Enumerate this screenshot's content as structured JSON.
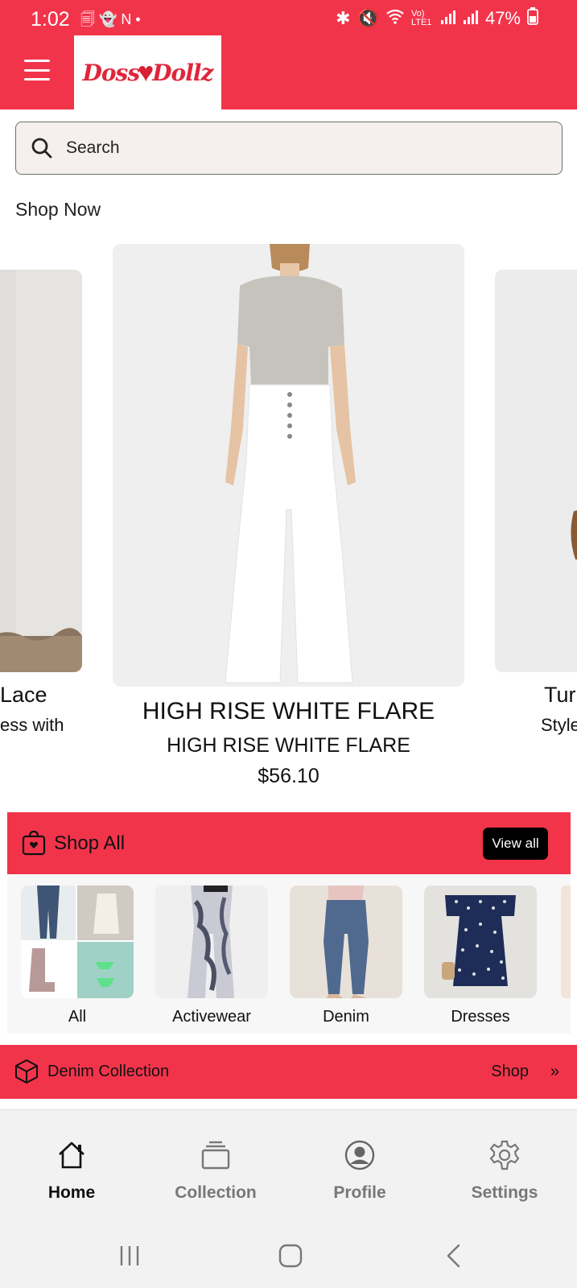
{
  "status_bar": {
    "time": "1:02",
    "notif_glyphs": "🗐 👻 N •",
    "network": "Vo) LTE1",
    "battery": "47%"
  },
  "app_bar": {
    "logo_left": "Doss",
    "logo_right": "Dollz"
  },
  "search": {
    "placeholder": "Search"
  },
  "shop_now": {
    "label": "Shop Now",
    "left_card": {
      "title": "Lace",
      "subtitle": "ess with"
    },
    "center_card": {
      "title": "HIGH RISE WHITE FLARE",
      "subtitle": "HIGH RISE WHITE FLARE",
      "price": "$56.10"
    },
    "right_card": {
      "title": "Tur",
      "subtitle": "Style"
    }
  },
  "shop_all": {
    "title": "Shop All",
    "view_all": "View all",
    "categories": [
      {
        "label": "All"
      },
      {
        "label": "Activewear"
      },
      {
        "label": "Denim"
      },
      {
        "label": "Dresses"
      }
    ]
  },
  "denim_collection": {
    "title": "Denim Collection",
    "shop": "Shop",
    "chevron": "»"
  },
  "bottom_nav": {
    "items": [
      {
        "label": "Home",
        "icon": "home-icon",
        "active": true
      },
      {
        "label": "Collection",
        "icon": "collection-icon",
        "active": false
      },
      {
        "label": "Profile",
        "icon": "profile-icon",
        "active": false
      },
      {
        "label": "Settings",
        "icon": "gear-icon",
        "active": false
      }
    ]
  },
  "colors": {
    "accent": "#f2344b",
    "logo_red": "#e0263b",
    "search_bg": "#f5f0ed"
  }
}
